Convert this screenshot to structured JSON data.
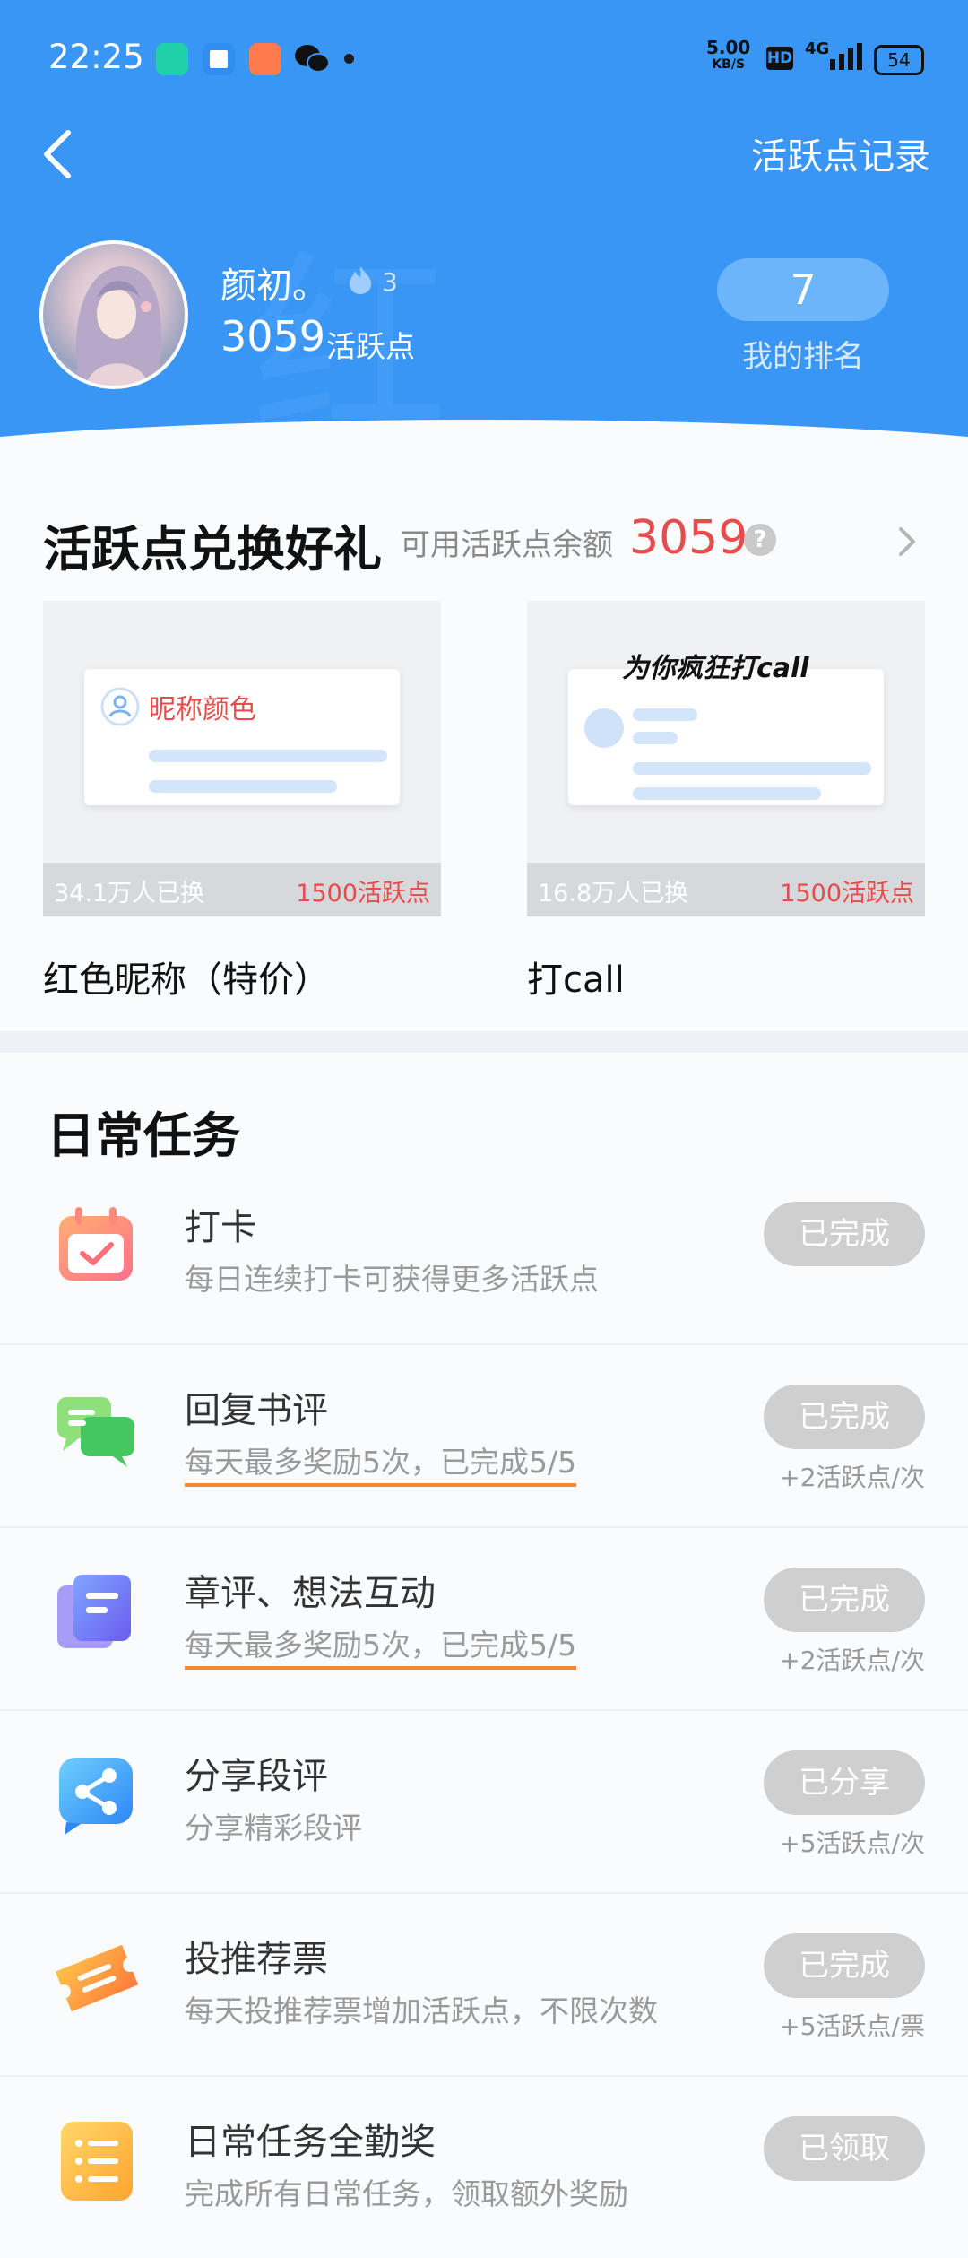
{
  "status_bar": {
    "time": "22:25",
    "speed_value": "5.00",
    "speed_unit": "KB/S",
    "hd": "HD",
    "network": "4G",
    "battery": "54"
  },
  "nav": {
    "record_link": "活跃点记录"
  },
  "profile": {
    "username": "颜初。",
    "fire_count": "3",
    "points": "3059",
    "points_unit": "活跃点",
    "rank": "7",
    "rank_label": "我的排名"
  },
  "exchange": {
    "title": "活跃点兑换好礼",
    "balance_label": "可用活跃点余额",
    "balance_value": "3059",
    "help": "?",
    "items": [
      {
        "name": "红色昵称（特价）",
        "swapped": "34.1万人已换",
        "cost": "1500活跃点",
        "preview_label": "昵称颜色"
      },
      {
        "name": "打call",
        "swapped": "16.8万人已换",
        "cost": "1500活跃点",
        "preview_label": "为你疯狂打call"
      }
    ]
  },
  "daily": {
    "title": "日常任务",
    "tasks": [
      {
        "title": "打卡",
        "desc": "每日连续打卡可获得更多活跃点",
        "button": "已完成",
        "reward": "",
        "icon": "calendar-check-icon",
        "underline": false
      },
      {
        "title": "回复书评",
        "desc": "每天最多奖励5次，已完成5/5",
        "button": "已完成",
        "reward": "+2活跃点/次",
        "icon": "chat-bubbles-icon",
        "underline": true
      },
      {
        "title": "章评、想法互动",
        "desc": "每天最多奖励5次，已完成5/5",
        "button": "已完成",
        "reward": "+2活跃点/次",
        "icon": "note-icon",
        "underline": true
      },
      {
        "title": "分享段评",
        "desc": "分享精彩段评",
        "button": "已分享",
        "reward": "+5活跃点/次",
        "icon": "share-icon",
        "underline": false
      },
      {
        "title": "投推荐票",
        "desc": "每天投推荐票增加活跃点，不限次数",
        "button": "已完成",
        "reward": "+5活跃点/票",
        "icon": "ticket-icon",
        "underline": false
      },
      {
        "title": "日常任务全勤奖",
        "desc": "完成所有日常任务，领取额外奖励",
        "button": "已领取",
        "reward": "",
        "icon": "list-icon",
        "underline": false
      }
    ]
  },
  "colors": {
    "header_blue": "#3a96f5",
    "accent_red": "#e84b4b",
    "button_gray": "#cfcfcf",
    "underline_orange": "#ef8a3a"
  }
}
